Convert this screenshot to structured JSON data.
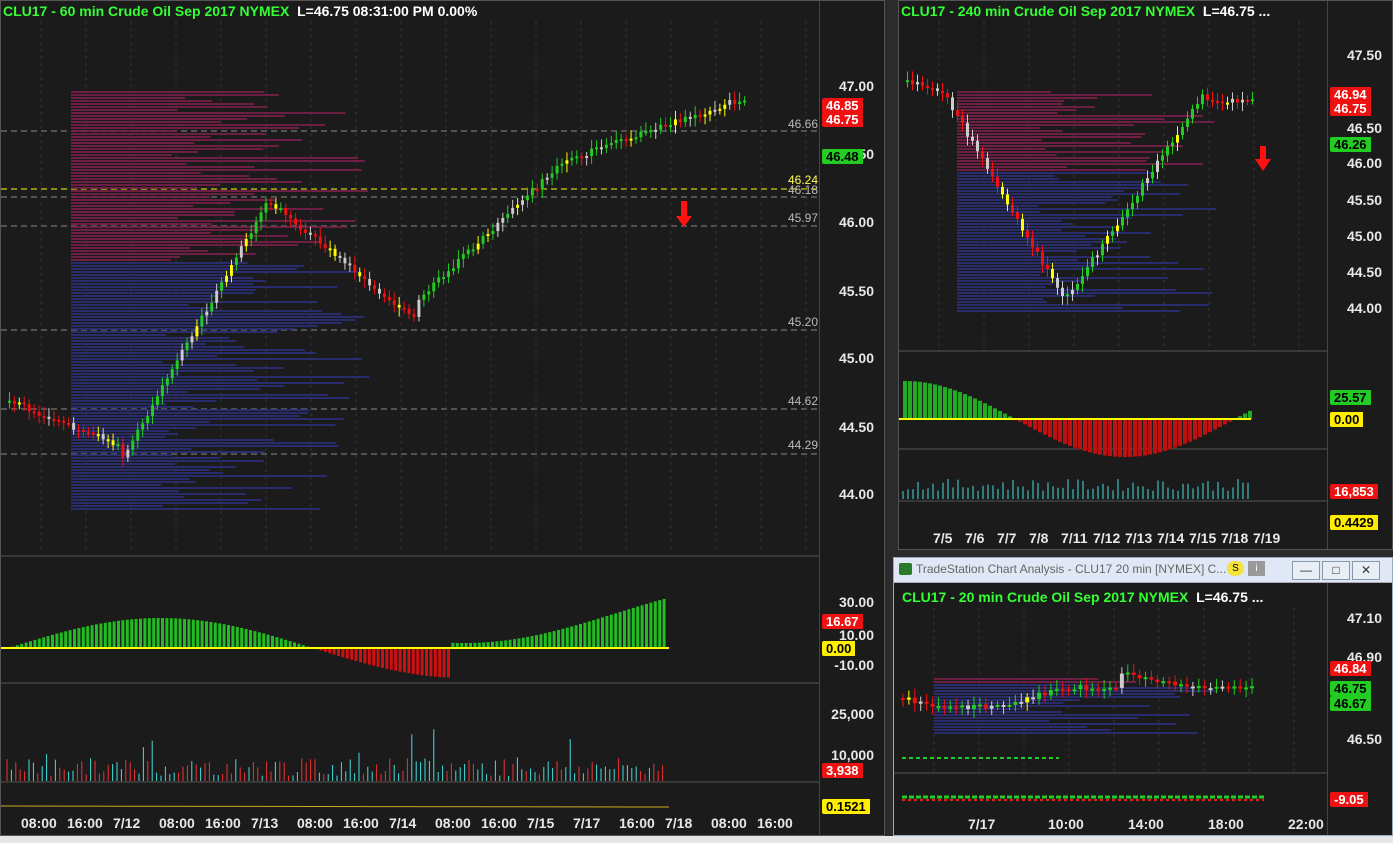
{
  "left": {
    "title_green": "CLU17 - 60 min  Crude Oil Sep 2017  NYMEX",
    "title_white": "L=46.75  08:31:00 PM  0.00%",
    "price_ticks": [
      "47.00",
      "46.50",
      "46.00",
      "45.50",
      "45.00",
      "44.50",
      "44.00"
    ],
    "tags": [
      "46.85",
      "46.75",
      "46.48"
    ],
    "line_labels": [
      "46.66",
      "46.24",
      "46.18",
      "45.97",
      "45.20",
      "44.62",
      "44.29"
    ],
    "ind_ticks": [
      "30.00",
      "10.00",
      "-10.00"
    ],
    "ind_tags": [
      "16.67",
      "0.00"
    ],
    "vol_ticks": [
      "25,000",
      "10,000"
    ],
    "vol_tag": "3,938",
    "sub_tag": "0.1521",
    "x_labels": [
      "08:00",
      "16:00",
      "7/12",
      "08:00",
      "16:00",
      "7/13",
      "08:00",
      "16:00",
      "7/14",
      "08:00",
      "16:00",
      "7/15",
      "7/17",
      "16:00",
      "7/18",
      "08:00",
      "16:00"
    ]
  },
  "topright": {
    "title_green": "CLU17 - 240 min  Crude Oil Sep 2017  NYMEX",
    "title_white": "L=46.75 ...",
    "price_ticks": [
      "47.50",
      "46.50",
      "46.00",
      "45.50",
      "45.00",
      "44.50",
      "44.00"
    ],
    "tags": [
      "46.94",
      "46.75",
      "46.26"
    ],
    "ind_tags": [
      "25.57",
      "0.00"
    ],
    "vol_tag": "16,853",
    "sub_tag": "0.4429",
    "x_labels": [
      "7/5",
      "7/6",
      "7/7",
      "7/8",
      "7/11",
      "7/12",
      "7/13",
      "7/14",
      "7/15",
      "7/18",
      "7/19"
    ]
  },
  "bottomright": {
    "window_title": "TradeStation Chart Analysis - CLU17 20 min [NYMEX] C...",
    "title_green": "CLU17 - 20 min  Crude Oil Sep 2017  NYMEX",
    "title_white": "L=46.75 ...",
    "price_ticks": [
      "47.10",
      "46.90",
      "46.50"
    ],
    "tags": [
      "46.84",
      "46.75",
      "46.67"
    ],
    "ind_tag": "-9.05",
    "x_labels": [
      "7/17",
      "10:00",
      "14:00",
      "18:00",
      "22:00"
    ],
    "buttons": {
      "minimize": "—",
      "restore": "□",
      "close": "✕"
    }
  },
  "colors": {
    "up": "#22cc22",
    "down": "#ee1111",
    "neutral": "#cccccc",
    "yellow": "#ffff00",
    "cyan": "#22ddee",
    "profile": "#443399"
  }
}
